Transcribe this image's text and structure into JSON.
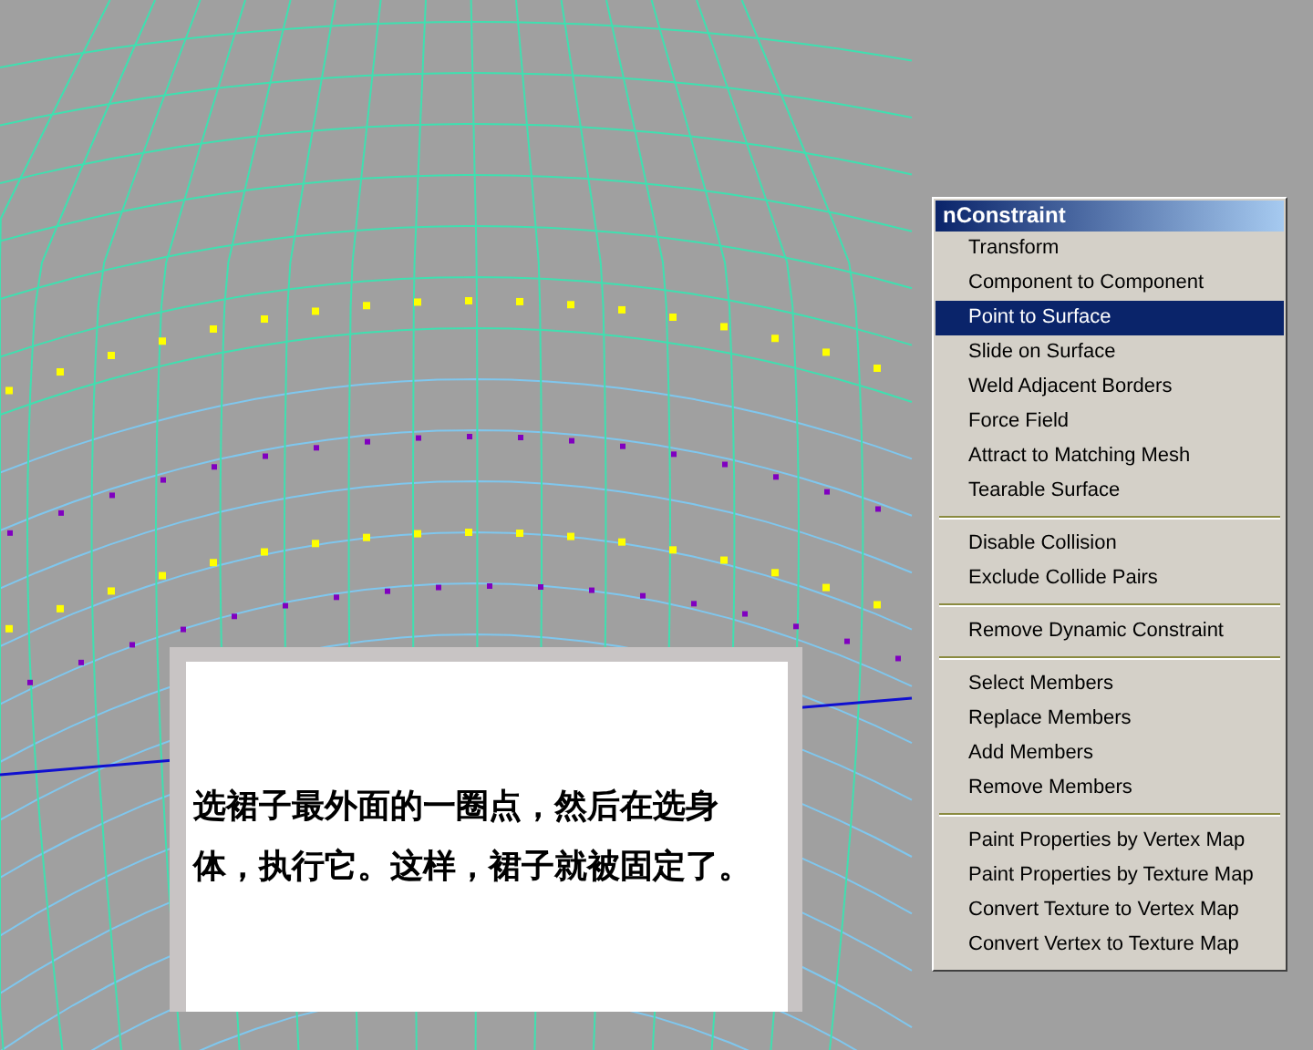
{
  "menu": {
    "title": "nConstraint",
    "groups": [
      [
        {
          "label": "Transform",
          "selected": false
        },
        {
          "label": "Component to Component",
          "selected": false
        },
        {
          "label": "Point to Surface",
          "selected": true
        },
        {
          "label": "Slide on Surface",
          "selected": false
        },
        {
          "label": "Weld Adjacent Borders",
          "selected": false
        },
        {
          "label": "Force Field",
          "selected": false
        },
        {
          "label": "Attract to Matching Mesh",
          "selected": false
        },
        {
          "label": "Tearable Surface",
          "selected": false
        }
      ],
      [
        {
          "label": "Disable Collision",
          "selected": false
        },
        {
          "label": "Exclude Collide Pairs",
          "selected": false
        }
      ],
      [
        {
          "label": "Remove Dynamic Constraint",
          "selected": false
        }
      ],
      [
        {
          "label": "Select Members",
          "selected": false
        },
        {
          "label": "Replace Members",
          "selected": false
        },
        {
          "label": "Add Members",
          "selected": false
        },
        {
          "label": "Remove Members",
          "selected": false
        }
      ],
      [
        {
          "label": "Paint Properties by Vertex Map",
          "selected": false
        },
        {
          "label": "Paint Properties by Texture Map",
          "selected": false
        },
        {
          "label": "Convert Texture to Vertex Map",
          "selected": false
        },
        {
          "label": "Convert Vertex to Texture Map",
          "selected": false
        }
      ]
    ]
  },
  "caption": {
    "text": "选裙子最外面的一圈点，然后在选身体，执行它。这样，裙子就被固定了。"
  }
}
